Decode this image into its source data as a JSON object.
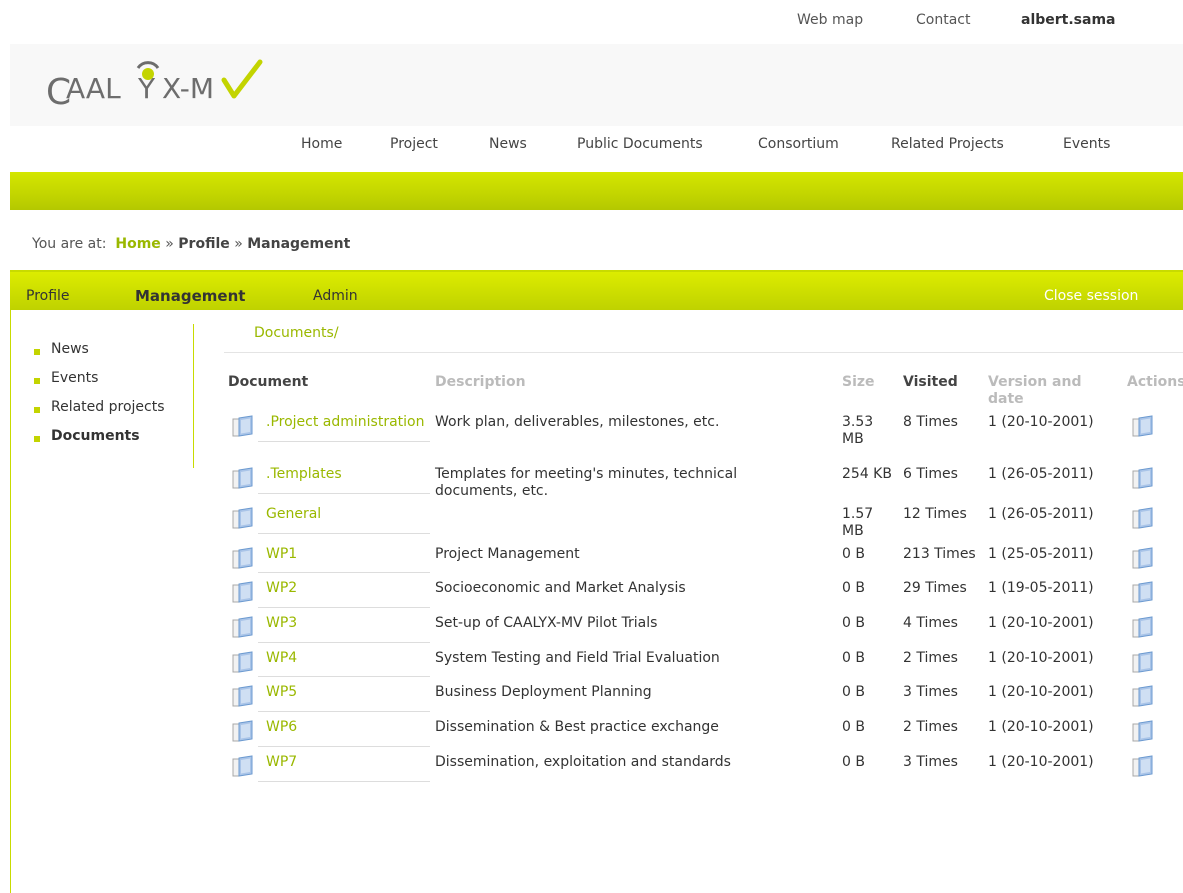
{
  "top_links": {
    "web_map": "Web map",
    "contact": "Contact",
    "user": "albert.sama"
  },
  "logo": {
    "text_left": "AAL",
    "text_right": "X-M",
    "letter_c": "C",
    "letter_y": "Y"
  },
  "main_nav": [
    "Home",
    "Project",
    "News",
    "Public Documents",
    "Consortium",
    "Related Projects",
    "Events"
  ],
  "breadcrumb": {
    "prefix": "You are at:",
    "home": "Home",
    "sep": "»",
    "profile": "Profile",
    "management": "Management"
  },
  "sub_tabs": {
    "profile": "Profile",
    "management": "Management",
    "admin": "Admin",
    "close_session": "Close session"
  },
  "side_menu": [
    "News",
    "Events",
    "Related projects",
    "Documents"
  ],
  "folder_path": "Documents/",
  "table": {
    "headers": {
      "document": "Document",
      "description": "Description",
      "size": "Size",
      "visited": "Visited",
      "version": "Version and date",
      "actions": "Actions"
    },
    "rows": [
      {
        "name": ".Project administration",
        "description": "Work plan, deliverables, milestones, etc.",
        "size": "3.53 MB",
        "visited": "8 Times",
        "version": "1 (20-10-2001)"
      },
      {
        "name": ".Templates",
        "description": "Templates for meeting's minutes, technical documents, etc.",
        "size": "254 KB",
        "visited": "6 Times",
        "version": "1 (26-05-2011)"
      },
      {
        "name": "General",
        "description": "",
        "size": "1.57 MB",
        "visited": "12 Times",
        "version": "1 (26-05-2011)"
      },
      {
        "name": "WP1",
        "description": "Project Management",
        "size": "0 B",
        "visited": "213 Times",
        "version": "1 (25-05-2011)"
      },
      {
        "name": "WP2",
        "description": "Socioeconomic and Market Analysis",
        "size": "0 B",
        "visited": "29 Times",
        "version": "1 (19-05-2011)"
      },
      {
        "name": "WP3",
        "description": "Set-up of CAALYX-MV Pilot Trials",
        "size": "0 B",
        "visited": "4 Times",
        "version": "1 (20-10-2001)"
      },
      {
        "name": "WP4",
        "description": "System Testing and Field Trial Evaluation",
        "size": "0 B",
        "visited": "2 Times",
        "version": "1 (20-10-2001)"
      },
      {
        "name": "WP5",
        "description": "Business Deployment Planning",
        "size": "0 B",
        "visited": "3 Times",
        "version": "1 (20-10-2001)"
      },
      {
        "name": "WP6",
        "description": "Dissemination & Best practice exchange",
        "size": "0 B",
        "visited": "2 Times",
        "version": "1 (20-10-2001)"
      },
      {
        "name": "WP7",
        "description": "Dissemination, exploitation and standards",
        "size": "0 B",
        "visited": "3 Times",
        "version": "1 (20-10-2001)"
      }
    ]
  },
  "colors": {
    "accent_green": "#c3d400",
    "link_green": "#9ab800",
    "logo_grey": "#6d6d6d",
    "folder_blue": "#6c9ad0"
  },
  "icons": {
    "folder": "folder-icon",
    "action": "folder-action-icon",
    "bullet": "bullet-icon"
  }
}
